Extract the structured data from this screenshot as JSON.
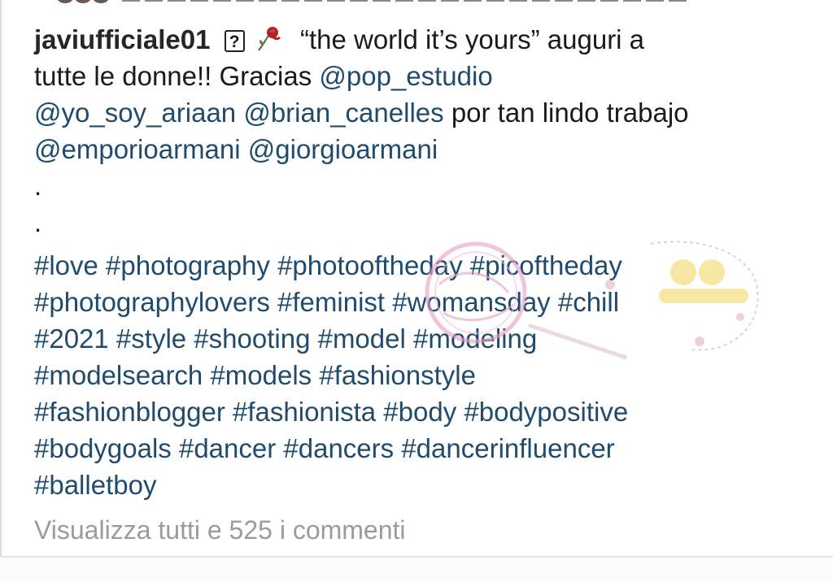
{
  "post": {
    "username": "javiufficiale01",
    "unknown_glyph": "?",
    "caption_lines": [
      "“the world it’s yours” auguri a",
      "tutte le donne!! Gracias ",
      "por tan lindo trabajo"
    ],
    "mentions": [
      "@pop_estudio",
      "@yo_soy_ariaan",
      "@brian_canelles",
      "@emporioarmani",
      "@giorgioarmani"
    ],
    "dots": [
      ".",
      "."
    ],
    "hashtag_lines": [
      "#love #photography #photooftheday #picoftheday",
      "#photographylovers #feminist #womansday #chill",
      "#2021 #style #shooting #model #modeling",
      "#modelsearch #models #fashionstyle",
      "#fashionblogger #fashionista #body #bodypositive",
      "#bodygoals #dancer #dancers #dancerinfluencer",
      "#balletboy"
    ],
    "view_comments": "Visualizza tutti e 525 i commenti"
  },
  "colors": {
    "link": "#1f4b6e",
    "text": "#1a1a1a",
    "muted": "#9b9b9b"
  },
  "icons": [
    "unknown-glyph-icon",
    "rose-icon"
  ]
}
